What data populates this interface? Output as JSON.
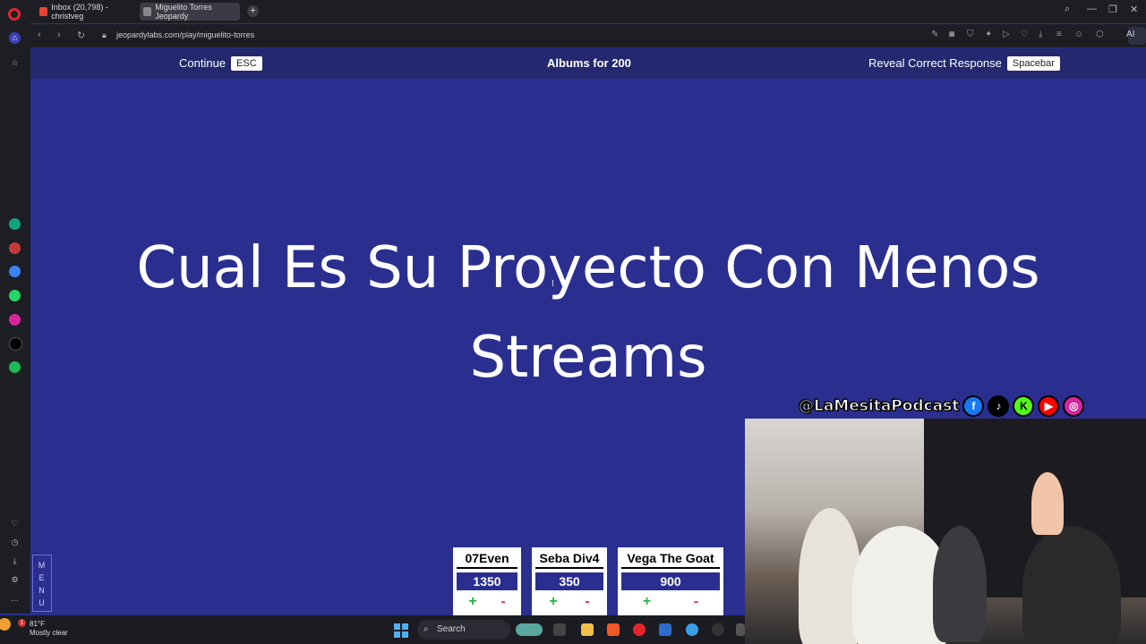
{
  "browser": {
    "tabs": [
      {
        "label": "Inbox (20,798) - christveg"
      },
      {
        "label": "Miguelito Torres Jeopardy"
      }
    ],
    "new_tab_symbol": "+",
    "url": "jeopardylabs.com/play/miguelito-torres",
    "ai_label": "AI"
  },
  "game": {
    "continue_label": "Continue",
    "continue_key": "ESC",
    "question_title": "Albums for 200",
    "reveal_label": "Reveal Correct Response",
    "reveal_key": "Spacebar",
    "question_line1": "Cual Es Su Proyecto Con Menos",
    "question_line2": "Streams",
    "menu_letters": [
      "M",
      "E",
      "N",
      "U"
    ],
    "teams": [
      {
        "name": "07Even",
        "score": "1350",
        "plus": "+",
        "minus": "-"
      },
      {
        "name": "Seba Div4",
        "score": "350",
        "plus": "+",
        "minus": "-"
      },
      {
        "name": "Vega The Goat",
        "score": "900",
        "plus": "+",
        "minus": "-"
      }
    ]
  },
  "stream": {
    "handle": "@LaMesitaPodcast",
    "social_icons": [
      "facebook-icon",
      "tiktok-icon",
      "kick-icon",
      "youtube-icon",
      "instagram-icon"
    ],
    "social_colors": [
      "#1877f2",
      "#000000",
      "#53fc18",
      "#ff0000",
      "#d6249f"
    ]
  },
  "taskbar": {
    "temperature": "81°F",
    "weather": "Mostly clear",
    "notification_count": "1",
    "search_label": "Search"
  },
  "colors": {
    "board_bg": "#2a2f8f",
    "header_bg": "#23286f",
    "plus": "#2bb24c",
    "minus": "#e03a3a"
  }
}
